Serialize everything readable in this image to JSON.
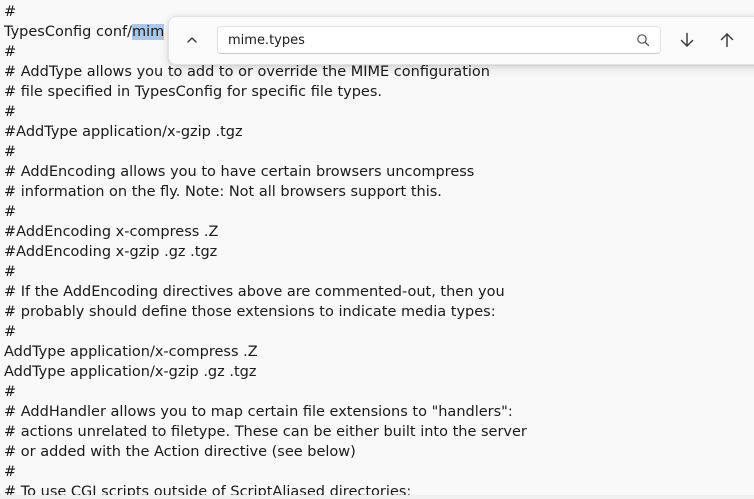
{
  "editor": {
    "lines": [
      {
        "pre": "#",
        "match": "",
        "post": ""
      },
      {
        "pre": "TypesConfig conf/",
        "match": "mim",
        "post": ""
      },
      {
        "pre": "#",
        "match": "",
        "post": ""
      },
      {
        "pre": "# AddType allows you to add to or override the MIME configuration",
        "match": "",
        "post": ""
      },
      {
        "pre": "# file specified in TypesConfig for specific file types.",
        "match": "",
        "post": ""
      },
      {
        "pre": "#",
        "match": "",
        "post": ""
      },
      {
        "pre": "#AddType application/x-gzip .tgz",
        "match": "",
        "post": ""
      },
      {
        "pre": "#",
        "match": "",
        "post": ""
      },
      {
        "pre": "# AddEncoding allows you to have certain browsers uncompress",
        "match": "",
        "post": ""
      },
      {
        "pre": "# information on the fly. Note: Not all browsers support this.",
        "match": "",
        "post": ""
      },
      {
        "pre": "#",
        "match": "",
        "post": ""
      },
      {
        "pre": "#AddEncoding x-compress .Z",
        "match": "",
        "post": ""
      },
      {
        "pre": "#AddEncoding x-gzip .gz .tgz",
        "match": "",
        "post": ""
      },
      {
        "pre": "#",
        "match": "",
        "post": ""
      },
      {
        "pre": "# If the AddEncoding directives above are commented-out, then you",
        "match": "",
        "post": ""
      },
      {
        "pre": "# probably should define those extensions to indicate media types:",
        "match": "",
        "post": ""
      },
      {
        "pre": "#",
        "match": "",
        "post": ""
      },
      {
        "pre": "AddType application/x-compress .Z",
        "match": "",
        "post": ""
      },
      {
        "pre": "AddType application/x-gzip .gz .tgz",
        "match": "",
        "post": ""
      },
      {
        "pre": "#",
        "match": "",
        "post": ""
      },
      {
        "pre": "# AddHandler allows you to map certain file extensions to \"handlers\":",
        "match": "",
        "post": ""
      },
      {
        "pre": "# actions unrelated to filetype. These can be either built into the server",
        "match": "",
        "post": ""
      },
      {
        "pre": "# or added with the Action directive (see below)",
        "match": "",
        "post": ""
      },
      {
        "pre": "#",
        "match": "",
        "post": ""
      },
      {
        "pre": "# To use CGI scripts outside of ScriptAliased directories:",
        "match": "",
        "post": ""
      }
    ],
    "highlight_color": "#a9c8ea"
  },
  "find": {
    "value": "mime.types",
    "toggle_icon": "chevron-up-icon",
    "search_icon": "search-icon",
    "next_icon": "arrow-down-icon",
    "prev_icon": "arrow-up-icon"
  }
}
